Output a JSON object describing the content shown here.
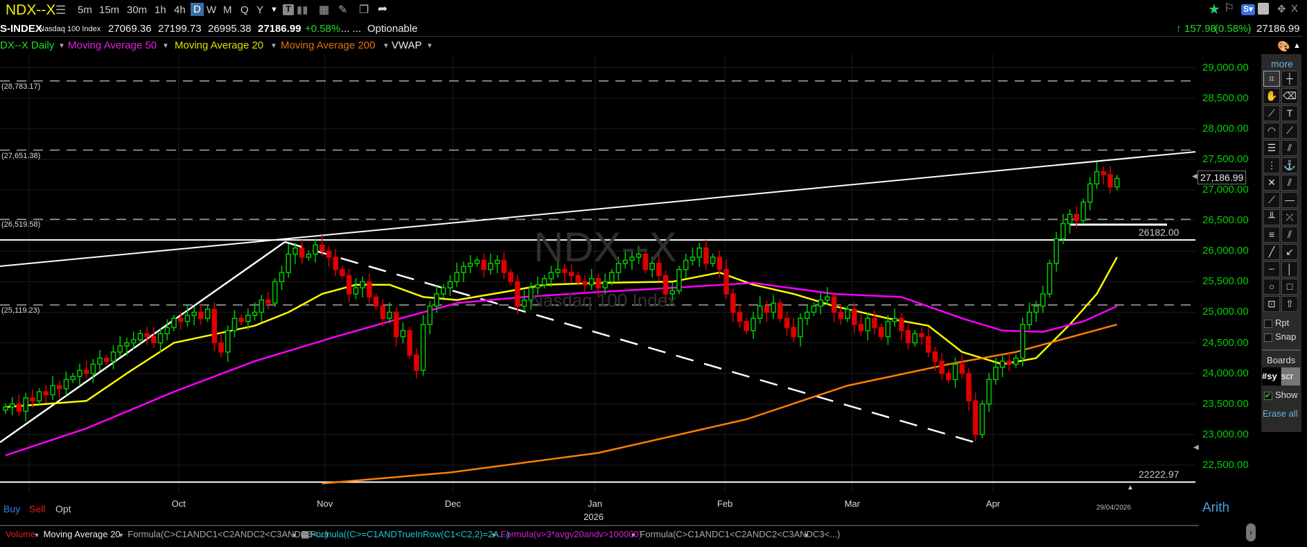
{
  "toolbar": {
    "symbol": "NDX--X",
    "timeframes": [
      "5m",
      "15m",
      "30m",
      "1h",
      "4h",
      "D",
      "W",
      "M",
      "Q",
      "Y"
    ],
    "selected_timeframe": "D"
  },
  "quote": {
    "exchange": "S-INDEX",
    "name": "Nasdaq 100 Index",
    "open": "27069.36",
    "high": "27199.73",
    "low": "26995.38",
    "last": "27186.99",
    "change_pct": "+0.58%",
    "ellipsis": "... ...",
    "optionable": "Optionable",
    "change": "157.98",
    "change_paren": "(0.58%)",
    "last_right": "27186.99"
  },
  "indicators": {
    "main": "DX--X Daily",
    "ma50": "Moving Average 50",
    "ma20": "Moving Average 20",
    "ma200": "Moving Average 200",
    "vwap": "VWAP"
  },
  "colors": {
    "up": "#00cc00",
    "down": "#e00000",
    "ma50": "#ff00ff",
    "ma20": "#ffff00",
    "ma200": "#ff8000",
    "axis": "#00d000"
  },
  "watermark": {
    "symbol": "NDX--X",
    "name": "Nasdaq 100 Index"
  },
  "right_tools": {
    "more": "more",
    "rpt": "Rpt",
    "snap": "Snap",
    "boards": "Boards",
    "board1": "#sy",
    "board2": "scr",
    "show": "Show",
    "erase_all": "Erase all"
  },
  "bottom": {
    "buy": "Buy",
    "sell": "Sell",
    "opt": "Opt",
    "scale": "Arith",
    "date": "29/04/2026",
    "year": "2026"
  },
  "lower_indicators": [
    "Volume",
    "Moving Average 20",
    "Formula(C>C1ANDC1<C2ANDC2<C3ANDC3<...)",
    "Formula((C>=C1ANDTrueInRow(C1<C2,2)=2A...)",
    "Formula(v>3*avgv20andv>100000)",
    "Formula(C>C1ANDC1<C2ANDC2<C3ANDC3<...)"
  ],
  "chart_data": {
    "type": "candlestick",
    "title": "NDX--X Daily",
    "ylim": [
      22300,
      29350
    ],
    "y_ticks": [
      29000,
      28500,
      28000,
      27500,
      27000,
      26500,
      26000,
      25500,
      25000,
      24500,
      24000,
      23500,
      23000,
      22500
    ],
    "y_tick_labels": [
      "29,000.00",
      "28,500.00",
      "28,000.00",
      "27,500.00",
      "27,000.00",
      "26,500.00",
      "26,000.00",
      "25,500.00",
      "25,000.00",
      "24,500.00",
      "24,000.00",
      "23,500.00",
      "23,000.00",
      "22,500.00"
    ],
    "x_labels": [
      {
        "label": "Oct",
        "day": 25.7
      },
      {
        "label": "Nov",
        "day": 47.4
      },
      {
        "label": "Dec",
        "day": 66.4
      },
      {
        "label": "Jan",
        "day": 87.5
      },
      {
        "label": "Feb",
        "day": 106.8
      },
      {
        "label": "Mar",
        "day": 125.7
      },
      {
        "label": "Apr",
        "day": 146.6
      }
    ],
    "current_price_label": "27,186.99",
    "closes": [
      23450,
      23500,
      23380,
      23600,
      23550,
      23700,
      23650,
      23800,
      23750,
      23900,
      23950,
      24050,
      24000,
      24150,
      24250,
      24200,
      24350,
      24450,
      24500,
      24550,
      24650,
      24600,
      24500,
      24650,
      24750,
      24900,
      24850,
      24950,
      25000,
      24900,
      25050,
      24500,
      24350,
      24700,
      24900,
      24850,
      24950,
      25000,
      25200,
      25150,
      25500,
      25650,
      25950,
      26050,
      25900,
      25950,
      26100,
      26000,
      25900,
      25700,
      25600,
      25300,
      25400,
      25500,
      25250,
      25100,
      24900,
      25000,
      24600,
      24700,
      24300,
      24050,
      24800,
      25100,
      25300,
      25400,
      25500,
      25650,
      25750,
      25800,
      25850,
      25700,
      25800,
      25850,
      25650,
      25500,
      25100,
      25200,
      25400,
      25450,
      25550,
      25650,
      25700,
      25650,
      25600,
      25500,
      25450,
      25550,
      25400,
      25500,
      25650,
      25800,
      25850,
      25900,
      25950,
      25700,
      25800,
      25600,
      25300,
      25350,
      25700,
      25850,
      25900,
      26050,
      25800,
      25900,
      25700,
      25300,
      25000,
      24850,
      24700,
      24900,
      25100,
      25000,
      25150,
      24900,
      24750,
      24600,
      24900,
      25000,
      25100,
      25200,
      25250,
      25000,
      24900,
      25050,
      24800,
      24700,
      24900,
      24750,
      24600,
      24850,
      24900,
      24700,
      24500,
      24650,
      24600,
      24350,
      24200,
      24000,
      23900,
      24150,
      24000,
      23550,
      23000,
      23500,
      23900,
      24100,
      24200,
      24150,
      24250,
      24800,
      25000,
      25100,
      25300,
      25800,
      26200,
      26450,
      26600,
      26500,
      26800,
      27100,
      27300,
      27250,
      27050,
      27186.99
    ],
    "series": [
      {
        "name": "Moving Average 20",
        "points": [
          [
            0,
            23450
          ],
          [
            12,
            23550
          ],
          [
            18,
            24000
          ],
          [
            25,
            24500
          ],
          [
            37,
            24780
          ],
          [
            42,
            25000
          ],
          [
            47,
            25300
          ],
          [
            52,
            25450
          ],
          [
            57,
            25450
          ],
          [
            62,
            25250
          ],
          [
            67,
            25200
          ],
          [
            74,
            25330
          ],
          [
            80,
            25450
          ],
          [
            88,
            25480
          ],
          [
            99,
            25500
          ],
          [
            106,
            25650
          ],
          [
            111,
            25450
          ],
          [
            117,
            25300
          ],
          [
            123,
            25100
          ],
          [
            131,
            24900
          ],
          [
            137,
            24780
          ],
          [
            142,
            24350
          ],
          [
            148,
            24150
          ],
          [
            153,
            24250
          ],
          [
            158,
            24800
          ],
          [
            162,
            25300
          ],
          [
            165,
            25900
          ]
        ]
      },
      {
        "name": "Moving Average 50",
        "points": [
          [
            0,
            22660
          ],
          [
            12,
            23100
          ],
          [
            25,
            23700
          ],
          [
            37,
            24200
          ],
          [
            49,
            24600
          ],
          [
            57,
            24850
          ],
          [
            67,
            25150
          ],
          [
            77,
            25250
          ],
          [
            88,
            25330
          ],
          [
            99,
            25400
          ],
          [
            111,
            25480
          ],
          [
            123,
            25300
          ],
          [
            133,
            25250
          ],
          [
            142,
            24900
          ],
          [
            148,
            24700
          ],
          [
            154,
            24680
          ],
          [
            160,
            24850
          ],
          [
            165,
            25100
          ]
        ]
      },
      {
        "name": "Moving Average 200",
        "points": [
          [
            47,
            22200
          ],
          [
            66,
            22380
          ],
          [
            88,
            22700
          ],
          [
            110,
            23250
          ],
          [
            125,
            23800
          ],
          [
            140,
            24150
          ],
          [
            150,
            24350
          ],
          [
            165,
            24800
          ]
        ]
      }
    ],
    "fib_levels": [
      {
        "value": 28783.17,
        "label": "(28,783.17)"
      },
      {
        "value": 27651.38,
        "label": "(27,651.38)"
      },
      {
        "value": 26519.58,
        "label": "(26,519.58)"
      },
      {
        "value": 25119.23,
        "label": "(25,119.23)"
      }
    ],
    "horizontal_lines": [
      {
        "value": 26182,
        "label": "26182.00"
      },
      {
        "value": 22222.97,
        "label": "22222.97"
      }
    ]
  }
}
